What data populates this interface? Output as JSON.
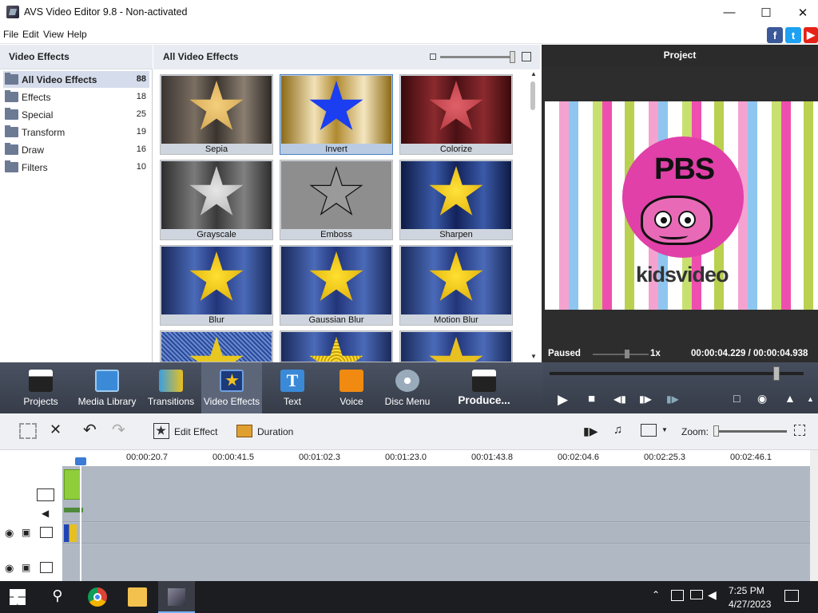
{
  "window": {
    "title": "AVS Video Editor 9.8 - Non-activated"
  },
  "menu": [
    "File",
    "Edit",
    "View",
    "Help"
  ],
  "left_panel": {
    "title": "Video Effects",
    "categories": [
      {
        "label": "All Video Effects",
        "count": "88",
        "selected": true
      },
      {
        "label": "Effects",
        "count": "18"
      },
      {
        "label": "Special",
        "count": "25"
      },
      {
        "label": "Transform",
        "count": "19"
      },
      {
        "label": "Draw",
        "count": "16"
      },
      {
        "label": "Filters",
        "count": "10"
      }
    ]
  },
  "center_panel": {
    "title": "All Video Effects",
    "effects": [
      "Sepia",
      "Invert",
      "Colorize",
      "Grayscale",
      "Emboss",
      "Sharpen",
      "Blur",
      "Gaussian Blur",
      "Motion Blur"
    ]
  },
  "preview": {
    "title": "Project",
    "logo_text": "PBS",
    "logo_subtext": "kidsvideo",
    "status": "Paused",
    "speed": "1x",
    "timecode": "00:00:04.229 / 00:00:04.938"
  },
  "toolbar": {
    "items": [
      "Projects",
      "Media Library",
      "Transitions",
      "Video Effects",
      "Text",
      "Voice",
      "Disc Menu",
      "Produce..."
    ],
    "selected": "Video Effects"
  },
  "timeline_toolbar": {
    "edit_effect": "Edit Effect",
    "duration": "Duration",
    "zoom_label": "Zoom:"
  },
  "timeline": {
    "ticks": [
      "00:00:20.7",
      "00:00:41.5",
      "00:01:02.3",
      "00:01:23.0",
      "00:01:43.8",
      "00:02:04.6",
      "00:02:25.3",
      "00:02:46.1"
    ]
  },
  "taskbar": {
    "time": "7:25 PM",
    "date": "4/27/2023"
  },
  "colors": {
    "accent": "#3a7bd5",
    "toolbar_bg": "#3f4654",
    "pbs_pink": "#e040a8"
  }
}
